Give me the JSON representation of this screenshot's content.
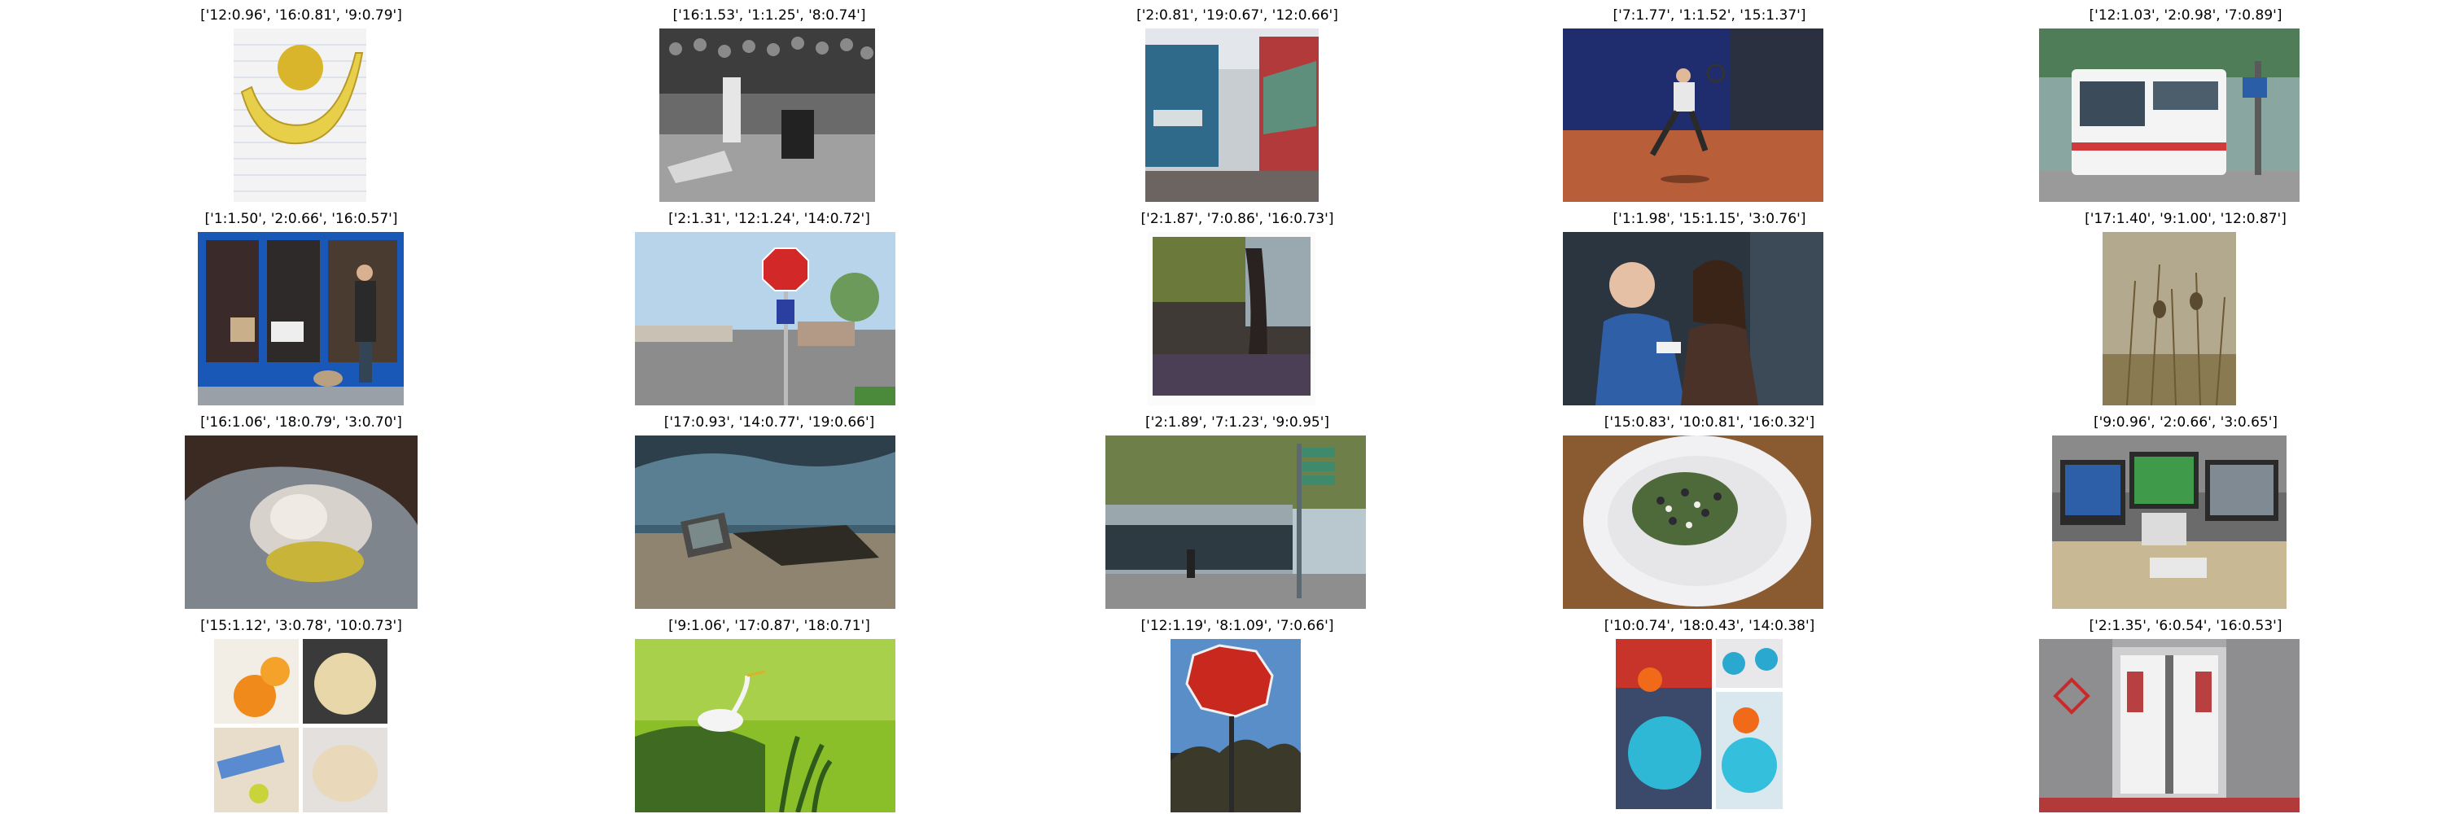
{
  "grid": {
    "rows": 4,
    "cols": 5,
    "items": [
      {
        "caption": "['12:0.96', '16:0.81', '9:0.79']",
        "image": "banana-and-orange-on-lined-paper"
      },
      {
        "caption": "['16:1.53', '1:1.25', '8:0.74']",
        "image": "black-white-baseball-slide-at-home-plate"
      },
      {
        "caption": "['2:0.81', '19:0.67', '12:0.66']",
        "image": "trailers-with-graffiti-at-street-corner"
      },
      {
        "caption": "['7:1.77', '1:1.52', '15:1.37']",
        "image": "tennis-player-on-clay-court"
      },
      {
        "caption": "['12:1.03', '2:0.98', '7:0.89']",
        "image": "white-city-bus-on-street"
      },
      {
        "caption": "['1:1.50', '2:0.66', '16:0.57']",
        "image": "woman-walking-dog-past-blue-storefront"
      },
      {
        "caption": "['2:1.31', '12:1.24', '14:0.72']",
        "image": "stop-sign-at-suburban-intersection"
      },
      {
        "caption": "['2:1.87', '7:0.86', '16:0.73']",
        "image": "tree-lined-sidewalk-photo"
      },
      {
        "caption": "['1:1.98', '15:1.15', '3:0.76']",
        "image": "elderly-man-and-woman-playing-video-game"
      },
      {
        "caption": "['17:1.40', '9:1.00', '12:0.87']",
        "image": "small-birds-on-dry-grass-stems"
      },
      {
        "caption": "['16:1.06', '18:0.79', '3:0.70']",
        "image": "cat-lying-in-grey-bag"
      },
      {
        "caption": "['17:0.93', '14:0.77', '19:0.66']",
        "image": "old-tv-on-beach-under-cloudy-sky"
      },
      {
        "caption": "['2:1.89', '7:1.23', '9:0.95']",
        "image": "street-crossing-with-station-and-signpost"
      },
      {
        "caption": "['15:0.83', '10:0.81', '16:0.32']",
        "image": "salad-on-white-plate"
      },
      {
        "caption": "['9:0.96', '2:0.66', '3:0.65']",
        "image": "desk-with-computer-monitors"
      },
      {
        "caption": "['15:1.12', '3:0.78', '10:0.73']",
        "image": "collage-of-oranges-and-tortillas"
      },
      {
        "caption": "['9:1.06', '17:0.87', '18:0.71']",
        "image": "white-egret-in-green-grass"
      },
      {
        "caption": "['12:1.19', '8:1.09', '7:0.66']",
        "image": "stop-sign-against-blue-sky"
      },
      {
        "caption": "['10:0.74', '18:0.43', '14:0.38']",
        "image": "blue-glass-vases-with-orange-flowers"
      },
      {
        "caption": "['2:1.35', '6:0.54', '16:0.53']",
        "image": "subway-train-doors-open"
      }
    ]
  }
}
